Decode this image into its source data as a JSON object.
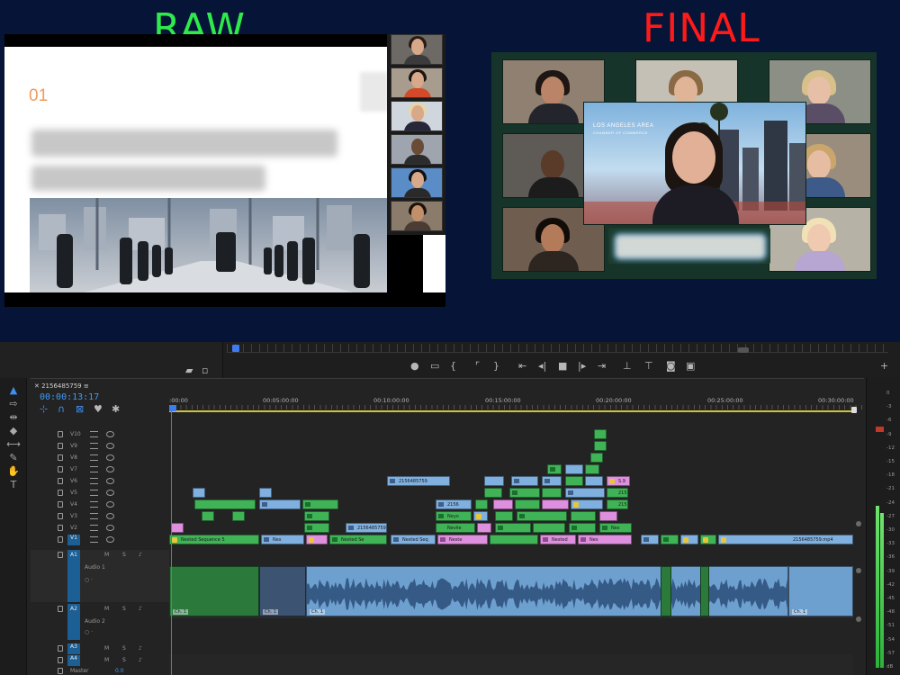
{
  "compare": {
    "raw_label": "RAW",
    "final_label": "FINAL",
    "raw": {
      "slide_number": "01",
      "participants": [
        "participant-1",
        "participant-2",
        "participant-3",
        "participant-4",
        "participant-5",
        "participant-6"
      ]
    },
    "final": {
      "featured_title_line1": "LOS ANGELES AREA",
      "featured_title_line2": "CHAMBER OF COMMERCE",
      "tiles": 8
    }
  },
  "timeline": {
    "sequence_name": "2156485759",
    "timecode": "00:00:13:17",
    "ruler": [
      ":00:00",
      "00:05:00:00",
      "00:10:00:00",
      "00:15:00:00",
      "00:20:00:00",
      "00:25:00:00",
      "00:30:00:00"
    ],
    "video_tracks": [
      "V10",
      "V9",
      "V8",
      "V7",
      "V6",
      "V5",
      "V4",
      "V3",
      "V2",
      "V1"
    ],
    "audio_tracks": [
      {
        "id": "A1",
        "name": "Audio 1"
      },
      {
        "id": "A2",
        "name": "Audio 2"
      },
      {
        "id": "A3",
        "name": ""
      },
      {
        "id": "A4",
        "name": ""
      }
    ],
    "master_label": "Master",
    "master_value": "0.0",
    "track_controls": {
      "mute": "M",
      "solo": "S"
    },
    "clip_labels": {
      "v7_a": "2156485759",
      "v4_a": "2156",
      "v3_a": "Neyo",
      "v2_a": "2156485759",
      "v2_b": "Nevile",
      "v2_c": "Nes",
      "v1_a": "Nested Sequence 5",
      "v1_b": "Nes",
      "v1_c": "Nested Se",
      "v1_d": "Nested Seq",
      "v1_e": "Neste",
      "v1_f": "Nested",
      "v1_g": "Nes",
      "v1_h": "2156485759.mp4",
      "v6_a": "S.9",
      "v5_a": "215",
      "v4_b": "215"
    },
    "audio_clip_label": "Ch. 1"
  },
  "meter": {
    "db_labels": [
      "0",
      "-3",
      "-6",
      "-9",
      "-12",
      "-15",
      "-18",
      "-21",
      "-24",
      "-27",
      "-30",
      "-33",
      "-36",
      "-39",
      "-42",
      "-45",
      "-48",
      "-51",
      "-54",
      "-57",
      "dB"
    ]
  },
  "colors": {
    "raw_label": "#2eea4a",
    "final_label": "#ff1a1a",
    "timecode": "#3e9bf5",
    "clip_green": "#3fb356",
    "clip_blue": "#7fb0e0",
    "clip_pink": "#de8fde"
  }
}
